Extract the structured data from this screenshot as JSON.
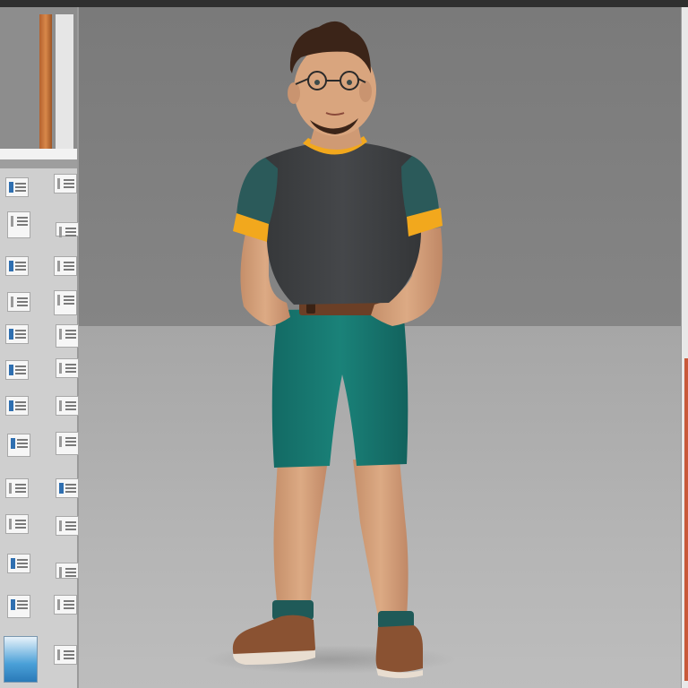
{
  "scene": {
    "subject_icon": "person-3d-character-icon",
    "colors": {
      "wall": "#7d7d7d",
      "floor": "#b0b0b0",
      "shirt": "#3e3f41",
      "shirt_sleeve": "#2b5a5a",
      "shirt_trim": "#f2a81d",
      "shorts": "#17766f",
      "skin": "#d6a07a",
      "hair": "#3b2418",
      "belt": "#6b3f26",
      "shoes": "#8a5232",
      "socks": "#1f5a58"
    }
  },
  "left_panel": {
    "preview_icon": "room-preview-icon",
    "thumbnail_icon": "document-thumbnail-icon"
  }
}
